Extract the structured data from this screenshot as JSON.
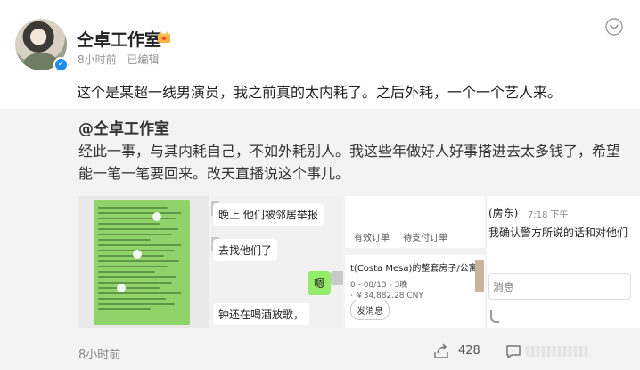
{
  "post": {
    "author": "仝卓工作室",
    "time": "8小时前",
    "edited": "已编辑",
    "text": "这个是某超一线男演员，我之前真的太内耗了。之后外耗，一个一个艺人来。"
  },
  "repost": {
    "author": "@仝卓工作室",
    "text": "经此一事，与其内耗自己，不如外耗别人。我这些年做好人好事搭进去太多钱了，希望能一笔一笔要回来。改天直播说这个事儿。",
    "images": {
      "chat2": {
        "line1": "晚上        他们被邻居举报",
        "line2": "去找他们了",
        "reply": "嗯",
        "line3": "钟还在喝酒放歌，"
      },
      "order": {
        "tab_valid": "有效订单",
        "tab_pending": "待支付订单",
        "listing": "t(Costa Mesa)的整套房子/公寓",
        "dates": "0 - 08/13 - 3晚",
        "price": "· ￥34,882.28 CNY",
        "button": "发消息"
      },
      "chat3": {
        "role": "(房东)",
        "time": "7:18 下午",
        "message": "我确认警方所说的话和对他们",
        "input": "消息"
      }
    },
    "time": "8小时前",
    "share_count": "428"
  },
  "icons": {
    "crown": "crown-icon",
    "verified": "verified-icon",
    "more": "chevron-down-icon",
    "share": "share-icon",
    "comment": "comment-icon"
  },
  "colors": {
    "verified": "#1d8cf0",
    "repost_bg": "#f3f3f3",
    "chat_green": "#95ec69"
  }
}
